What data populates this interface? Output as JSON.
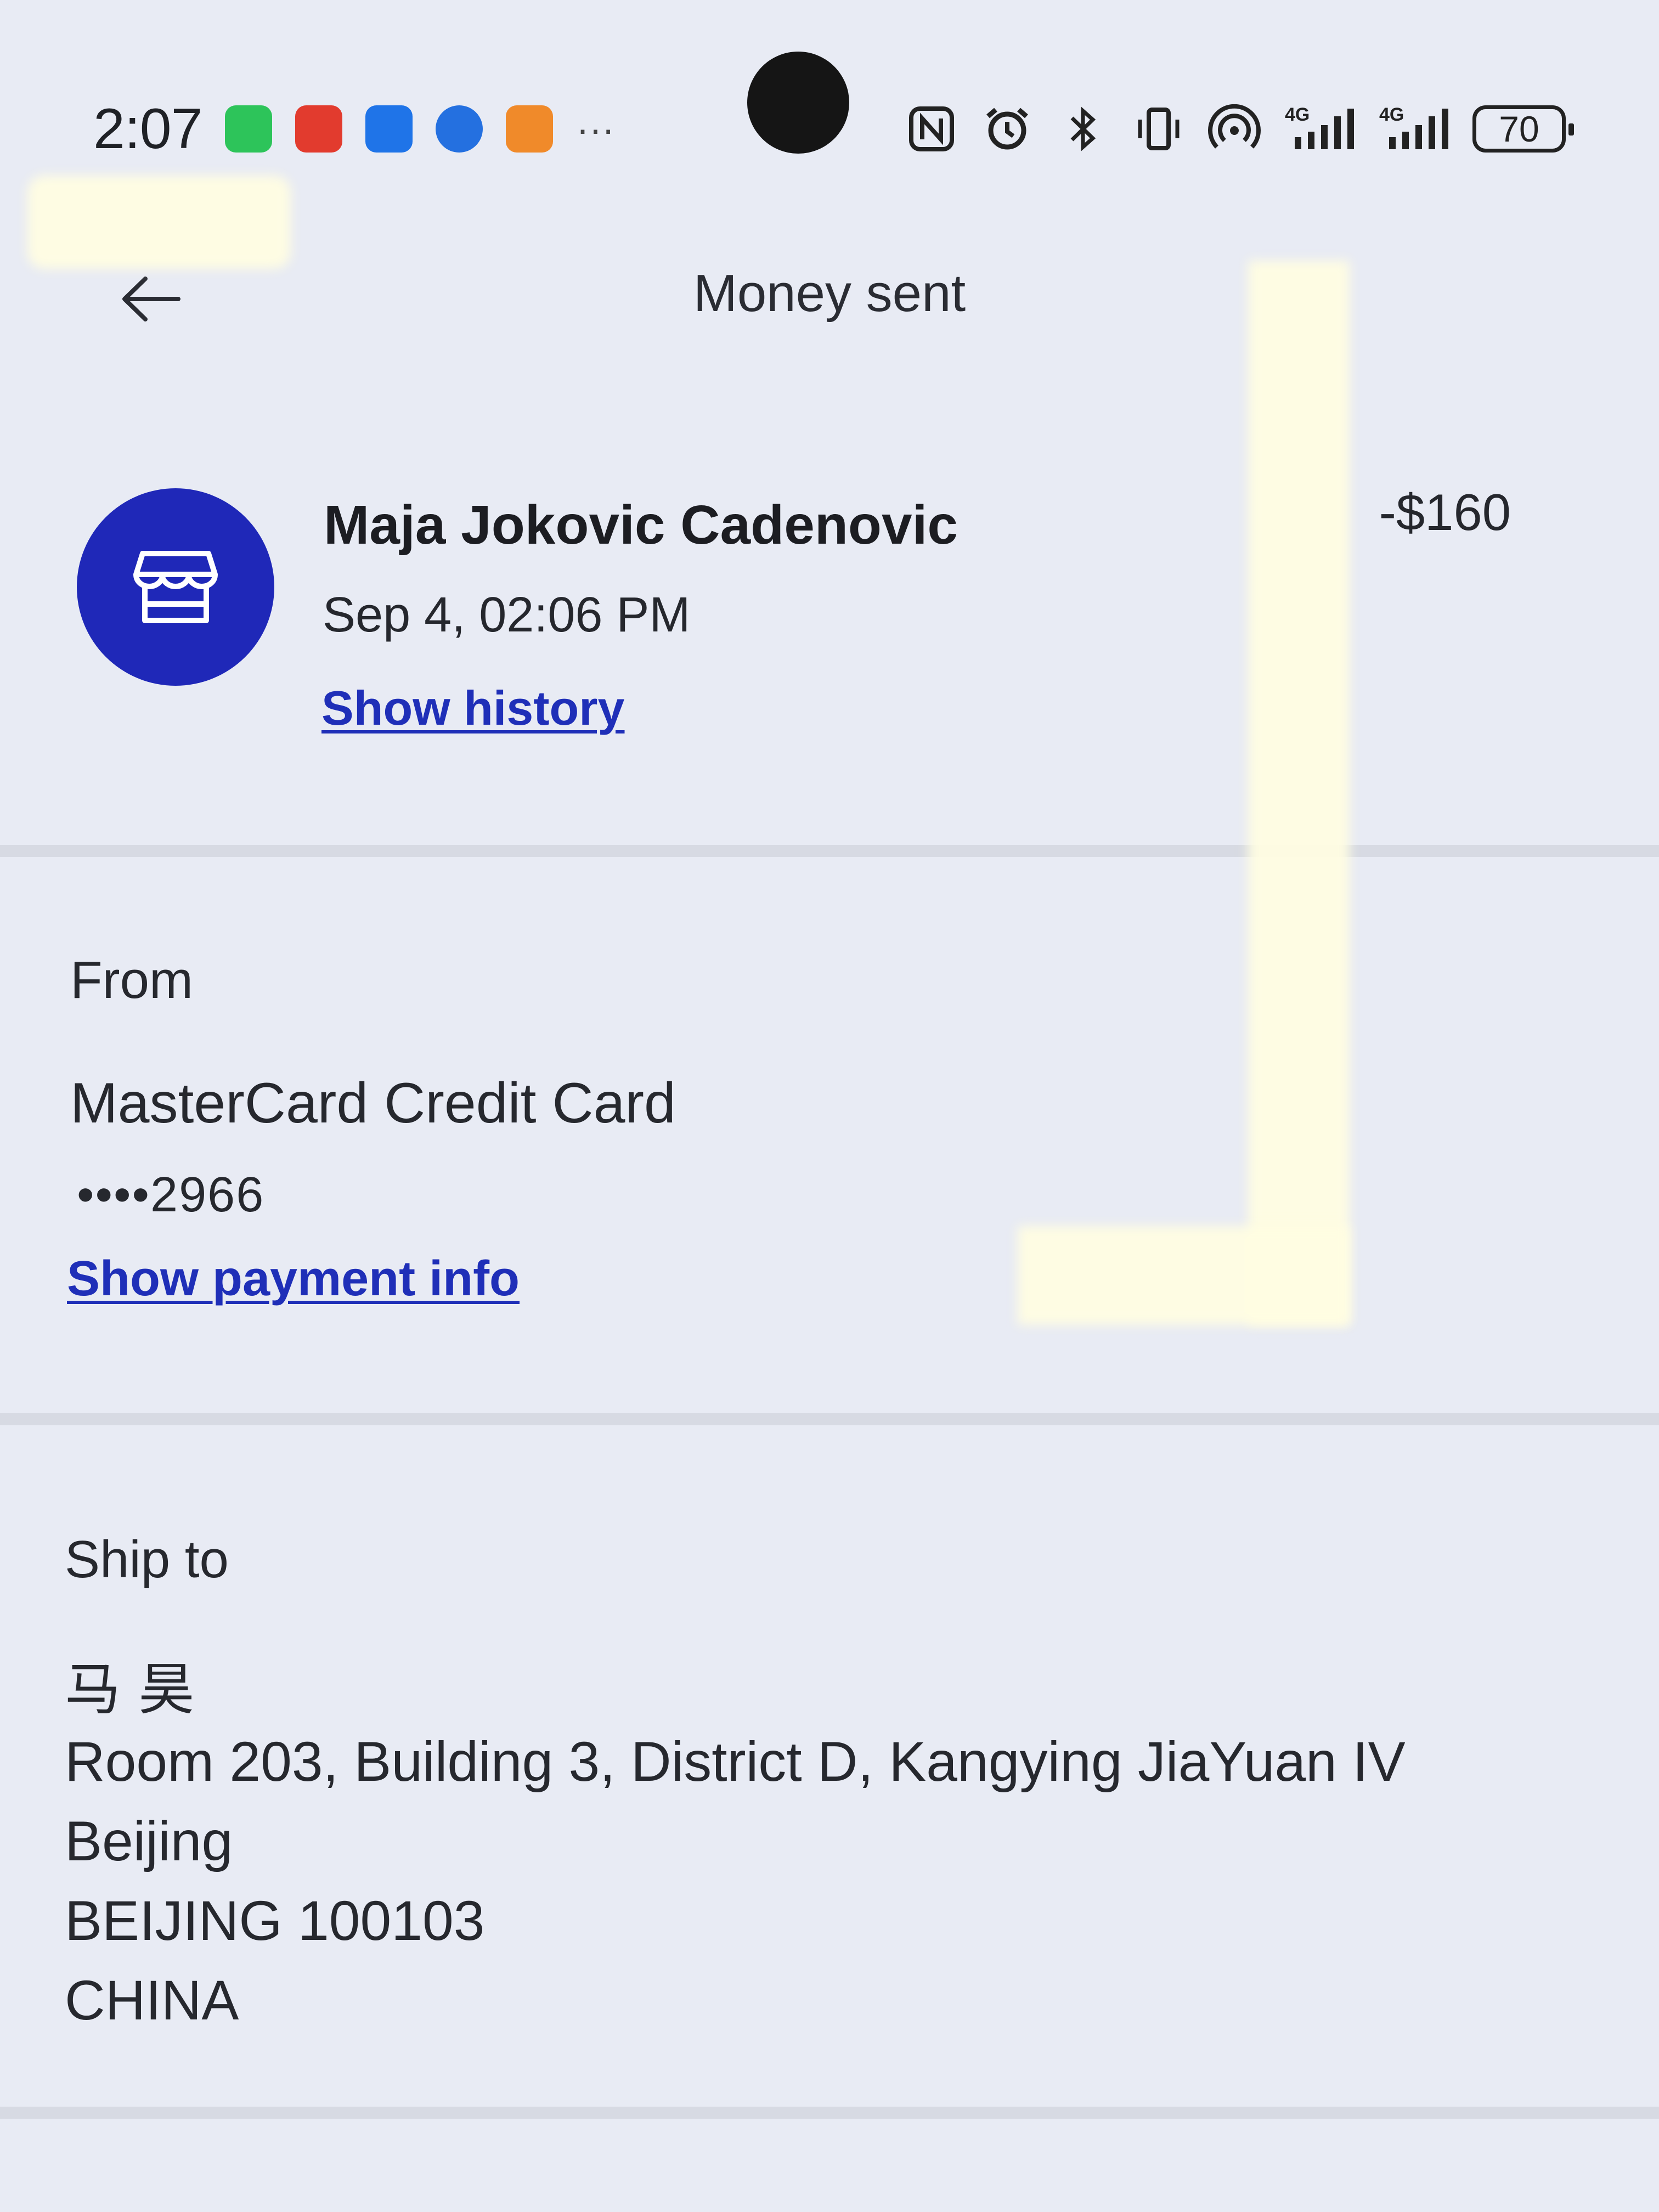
{
  "status_bar": {
    "time": "2:07",
    "more_indicator": "···",
    "battery_level": "70",
    "notification_icons": [
      {
        "name": "wechat-icon",
        "color": "#2dc45a"
      },
      {
        "name": "red-app-icon",
        "color": "#e23b2e"
      },
      {
        "name": "message-app-icon",
        "color": "#1f74e8"
      },
      {
        "name": "browser-icon",
        "color": "#2470e0"
      },
      {
        "name": "orange-app-icon",
        "color": "#f08a2a"
      }
    ],
    "system_icons": [
      "nfc-icon",
      "alarm-icon",
      "bluetooth-icon",
      "vibrate-icon",
      "hotspot-icon",
      "signal-4g-icon",
      "signal-4g-icon"
    ],
    "network_label": "4G"
  },
  "header": {
    "title": "Money sent",
    "back_icon": "arrow-left-icon"
  },
  "transaction": {
    "merchant_name": "Maja Jokovic Cadenovic",
    "date": "Sep 4, 02:06 PM",
    "show_history_label": "Show history",
    "amount": "-$160",
    "avatar_icon": "storefront-icon",
    "avatar_color": "#1f28b8"
  },
  "from": {
    "label": "From",
    "card_name": "MasterCard Credit Card",
    "card_number": "••••2966",
    "show_payment_label": "Show payment info"
  },
  "ship_to": {
    "label": "Ship to",
    "name": "马 昊",
    "address_lines": [
      "Room 203, Building 3, District D, Kangying JiaYuan IV",
      "Beijing",
      "BEIJING 100103",
      "CHINA"
    ]
  },
  "colors": {
    "link": "#1f2fb8",
    "background": "#e8ebf4",
    "text": "#26282e"
  }
}
